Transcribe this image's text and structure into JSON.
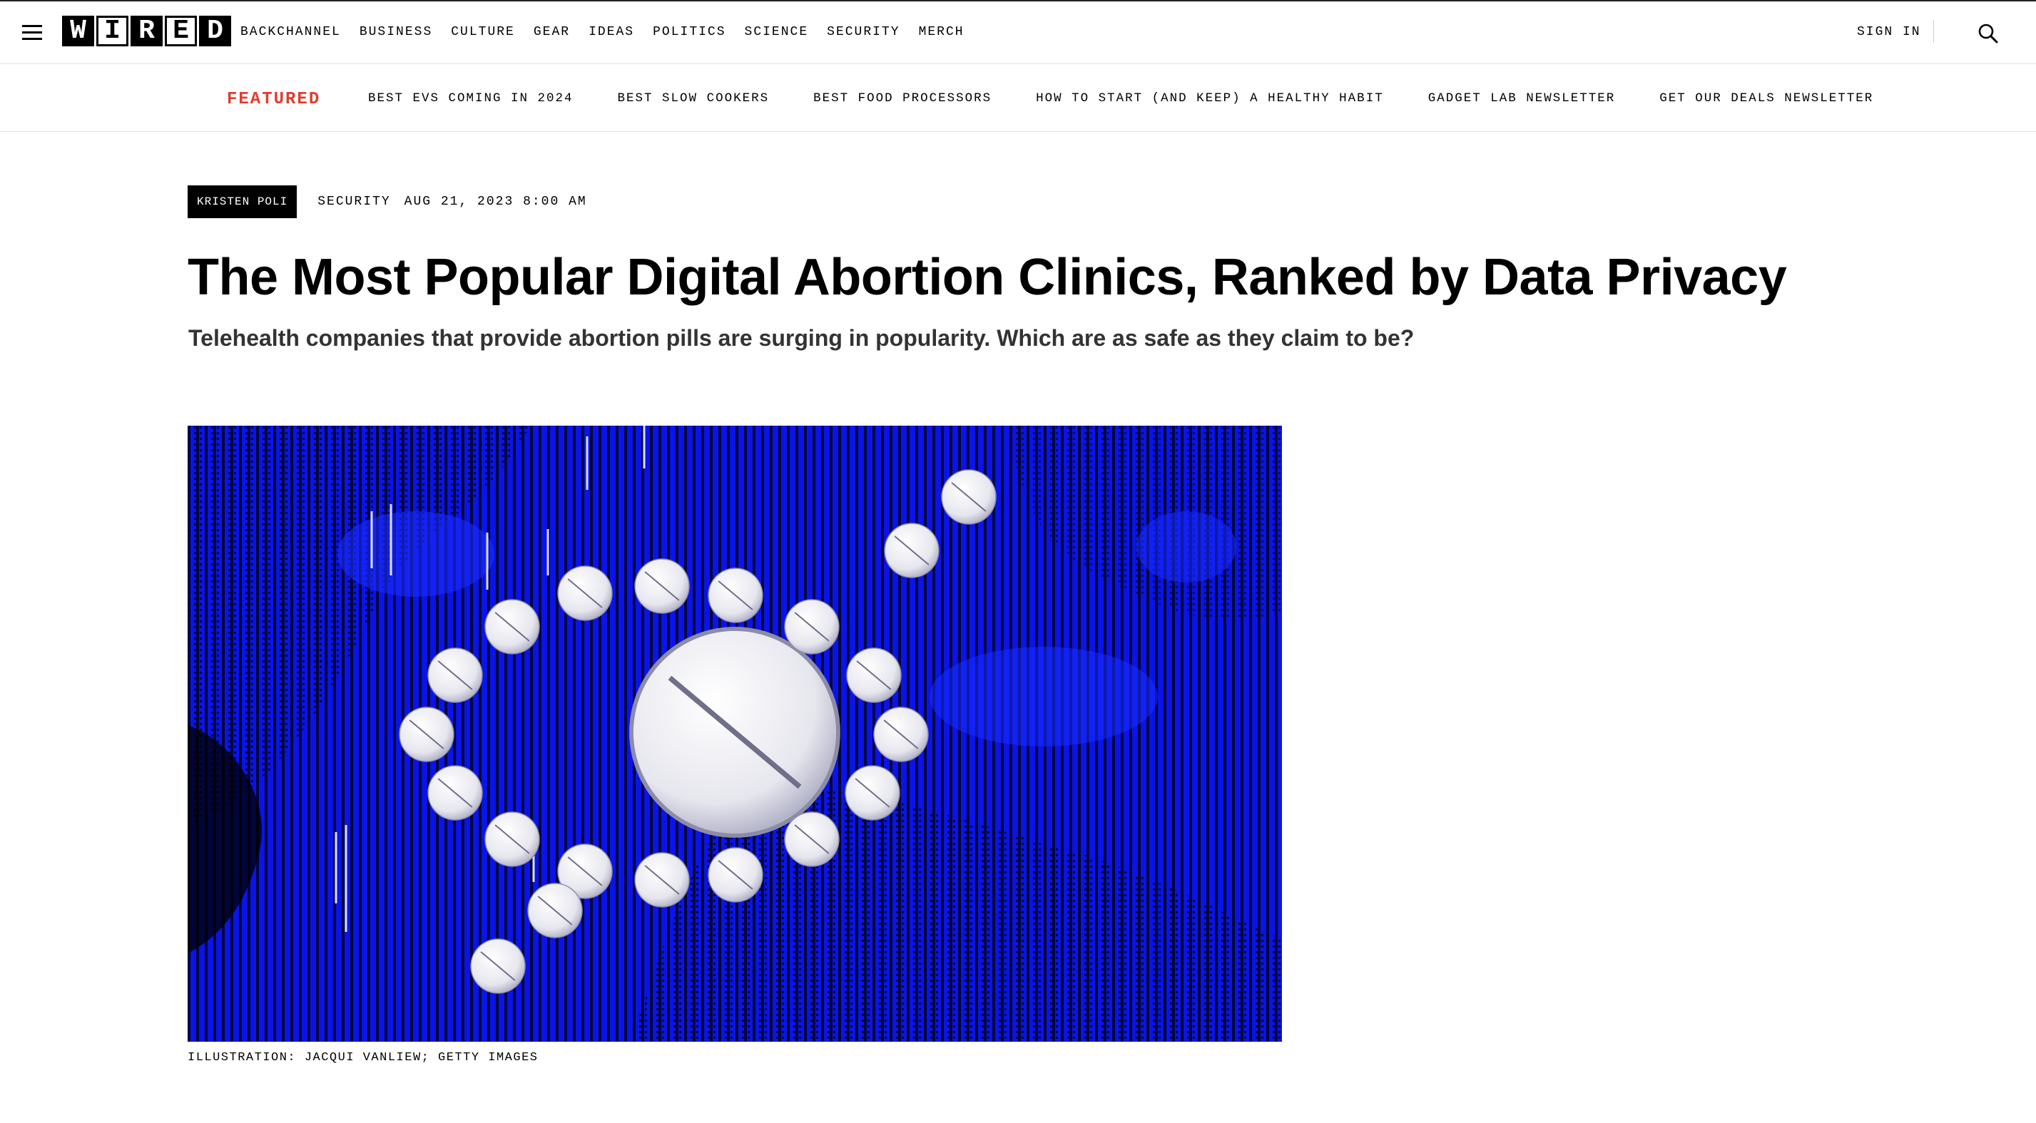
{
  "nav": {
    "logo_letters": [
      "W",
      "I",
      "R",
      "E",
      "D"
    ],
    "links": [
      "BACKCHANNEL",
      "BUSINESS",
      "CULTURE",
      "GEAR",
      "IDEAS",
      "POLITICS",
      "SCIENCE",
      "SECURITY",
      "MERCH"
    ],
    "sign_in": "SIGN IN",
    "menu_icon": "hamburger-icon",
    "search_icon": "search-icon"
  },
  "featured": {
    "label": "FEATURED",
    "links": [
      "BEST EVS COMING IN 2024",
      "BEST SLOW COOKERS",
      "BEST FOOD PROCESSORS",
      "HOW TO START (AND KEEP) A HEALTHY HABIT",
      "GADGET LAB NEWSLETTER",
      "GET OUR DEALS NEWSLETTER"
    ]
  },
  "article": {
    "author": "KRISTEN POLI",
    "section": "SECURITY",
    "date": "AUG 21, 2023 8:00 AM",
    "headline": "The Most Popular Digital Abortion Clinics, Ranked by Data Privacy",
    "dek": "Telehealth companies that provide abortion pills are surging in popularity. Which are as safe as they claim to be?",
    "caption": "ILLUSTRATION: JACQUI VANLIEW; GETTY IMAGES"
  },
  "colors": {
    "accent_featured": "#e13d2f",
    "hero_blue": "#0a14e6"
  }
}
